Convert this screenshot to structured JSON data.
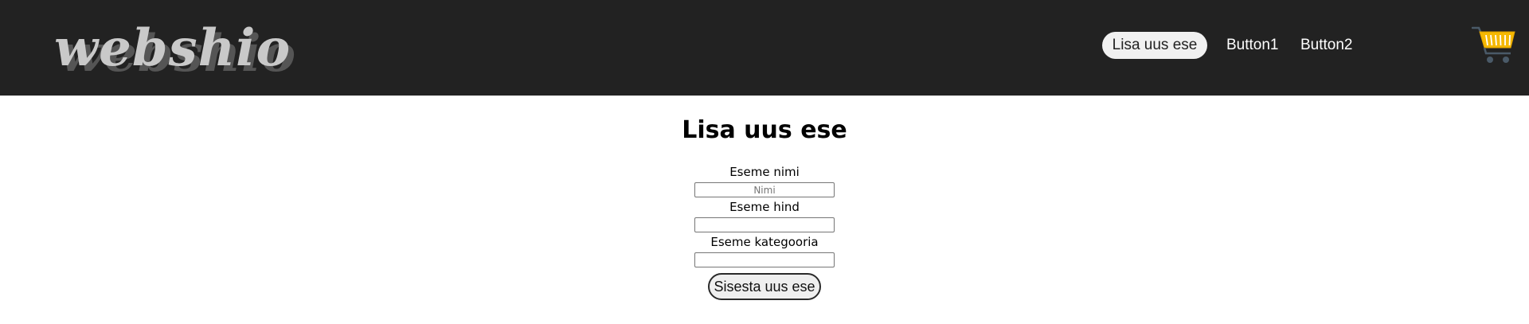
{
  "header": {
    "logo_text": "webshio",
    "nav": {
      "active_label": "Lisa uus ese",
      "button1_label": "Button1",
      "button2_label": "Button2"
    },
    "cart_icon": "shopping-cart-icon"
  },
  "form": {
    "title": "Lisa uus ese",
    "name_label": "Eseme nimi",
    "name_placeholder": "Nimi",
    "name_value": "",
    "price_label": "Eseme hind",
    "price_value": "",
    "category_label": "Eseme kategooria",
    "category_value": "",
    "submit_label": "Sisesta uus ese"
  },
  "colors": {
    "navbar_bg": "#222222",
    "logo": "#c9c9c9",
    "cart": "#f5b800",
    "cart_wheels": "#4a5a68"
  }
}
